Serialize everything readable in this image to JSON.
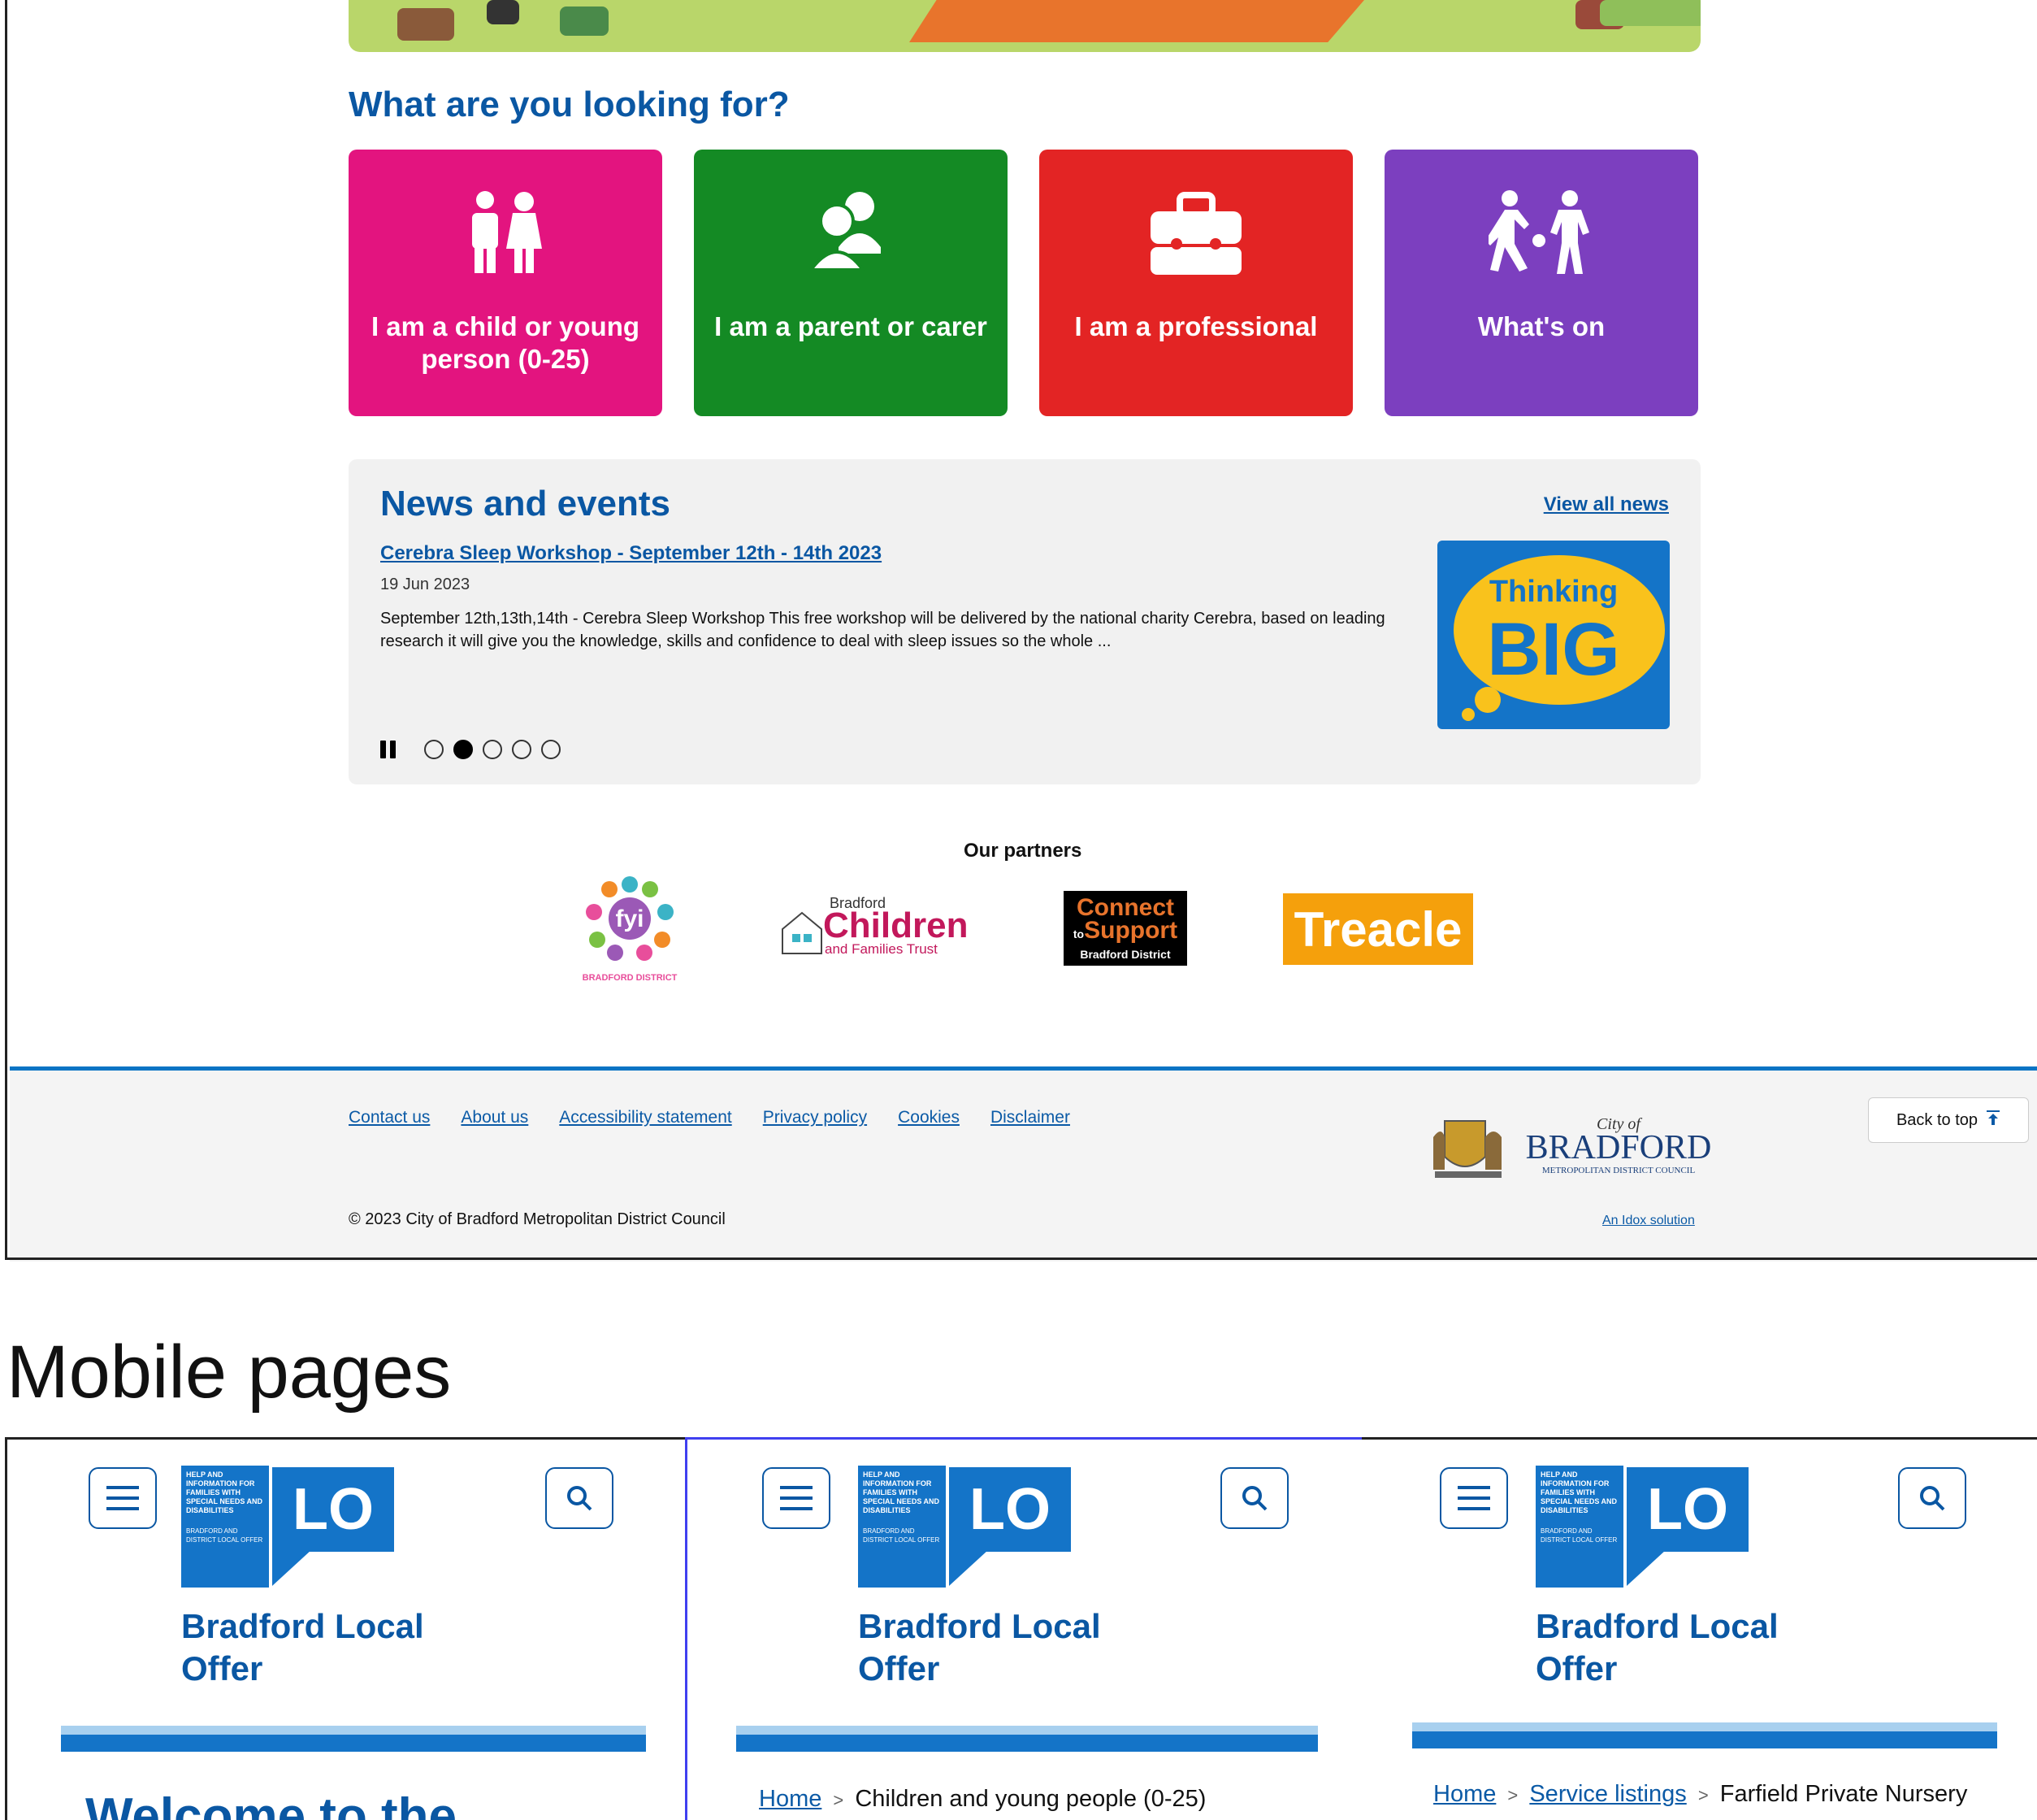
{
  "desktop": {
    "question_heading": "What are you looking for?",
    "tiles": [
      {
        "label": "I am a child or young person (0-25)",
        "color": "#e3147f",
        "icon": "children-icon"
      },
      {
        "label": "I am a parent or carer",
        "color": "#148a24",
        "icon": "parents-icon"
      },
      {
        "label": "I am a professional",
        "color": "#e32424",
        "icon": "briefcase-icon"
      },
      {
        "label": "What's on",
        "color": "#7c3fbf",
        "icon": "play-icon"
      }
    ],
    "news": {
      "heading": "News and events",
      "view_all": "View all news",
      "item_title": "Cerebra Sleep Workshop - September 12th - 14th 2023",
      "item_date": "19 Jun 2023",
      "item_body": "September 12th,13th,14th - Cerebra Sleep Workshop This free workshop will be delivered by the national charity Cerebra, based on leading research it will give you the knowledge, skills and confidence to deal with sleep issues so the whole ...",
      "image_text_1": "Thinking",
      "image_text_2": "BIG",
      "slides_total": 5,
      "slide_active": 2
    },
    "partners": {
      "heading": "Our partners",
      "logos": [
        {
          "name": "fyi",
          "subtext": "BRADFORD DISTRICT"
        },
        {
          "name": "Bradford Children and Families Trust",
          "line1": "Bradford",
          "line2": "Children",
          "line3": "and Families Trust"
        },
        {
          "name": "Connect to Support",
          "line1": "Connect",
          "line2": "to",
          "line3": "Support",
          "line4": "Bradford District"
        },
        {
          "name": "Treacle",
          "text": "Treacle"
        }
      ]
    },
    "footer": {
      "links": [
        "Contact us",
        "About us",
        "Accessibility statement",
        "Privacy policy",
        "Cookies",
        "Disclaimer"
      ],
      "copyright": "© 2023 City of Bradford Metropolitan District Council",
      "council_city_of": "City of",
      "council_name": "BRADFORD",
      "council_sub": "METROPOLITAN DISTRICT COUNCIL",
      "idox": "An Idox solution",
      "back_to_top": "Back to top"
    }
  },
  "mobile_heading": "Mobile pages",
  "mobile": {
    "logo_small_text": "HELP AND INFORMATION FOR FAMILIES WITH SPECIAL NEEDS AND DISABILITIES",
    "logo_small_footer": "BRADFORD AND DISTRICT LOCAL OFFER",
    "logo_letters": "LO",
    "site_title_line1": "Bradford Local",
    "site_title_line2": "Offer",
    "page1_heading": "Welcome to the",
    "page2_crumb_home": "Home",
    "page2_crumb_current": "Children and young people (0-25)",
    "page3_crumb_home": "Home",
    "page3_crumb_mid": "Service listings",
    "page3_crumb_current": "Farfield Private Nursery",
    "crumb_sep": ">"
  }
}
